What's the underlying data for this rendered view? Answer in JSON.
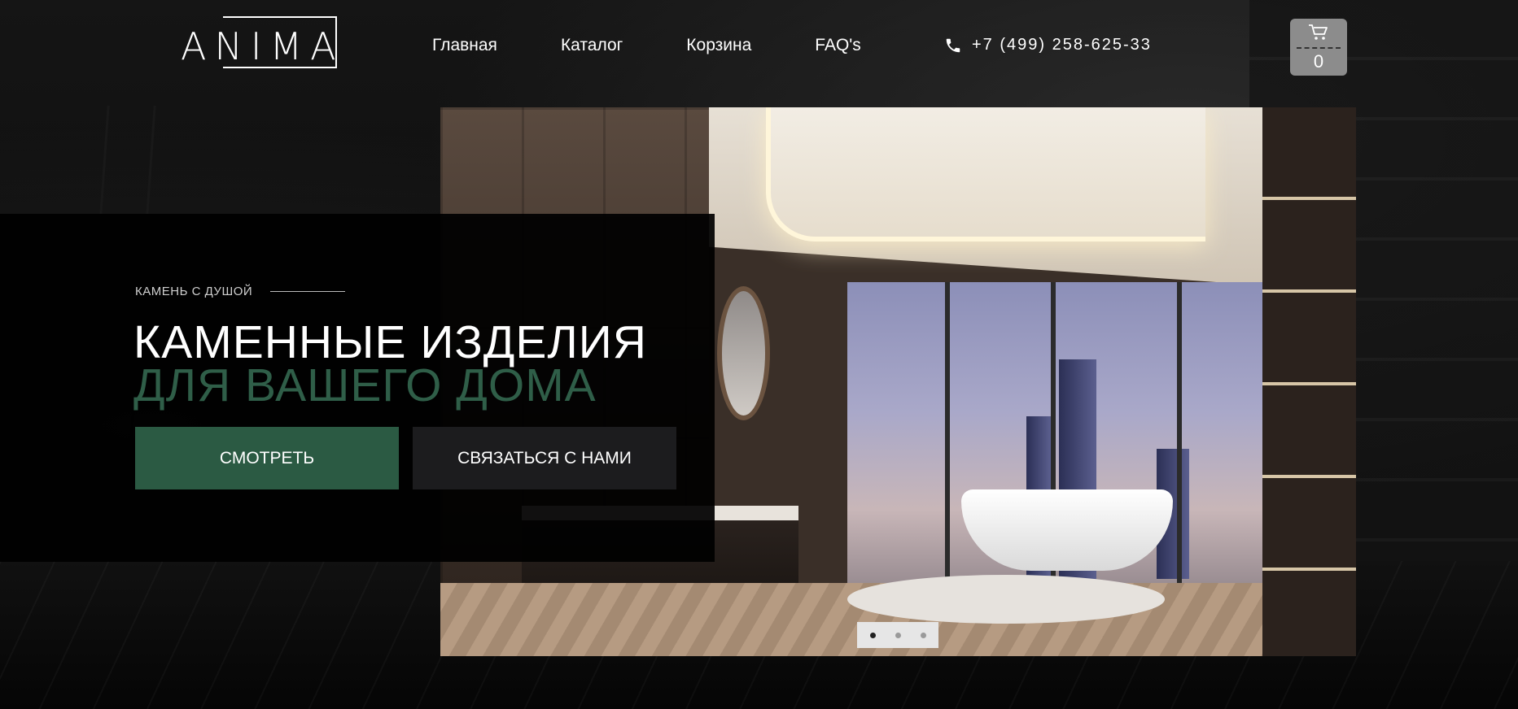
{
  "header": {
    "logo_text": "ANIMA",
    "nav": [
      {
        "label": "Главная"
      },
      {
        "label": "Каталог"
      },
      {
        "label": "Корзина"
      },
      {
        "label": "FAQ's"
      }
    ],
    "phone": "+7 (499) 258-625-33",
    "cart_count": "0"
  },
  "hero": {
    "kicker": "КАМЕНЬ С ДУШОЙ",
    "title_line1": "КАМЕННЫЕ ИЗДЕЛИЯ",
    "title_line2": "ДЛЯ ВАШЕГО ДОМА",
    "button_view": "СМОТРЕТЬ",
    "button_contact": "СВЯЗАТЬСЯ С НАМИ"
  },
  "slider": {
    "slides_total": 3,
    "active_slide": 1
  },
  "colors": {
    "accent_green": "#2b5a43",
    "title_green": "#2f5e48",
    "cart_bg": "#8c8c8c",
    "panel_bg": "#000000"
  },
  "icons": {
    "phone": "phone-icon",
    "cart": "cart-icon"
  }
}
